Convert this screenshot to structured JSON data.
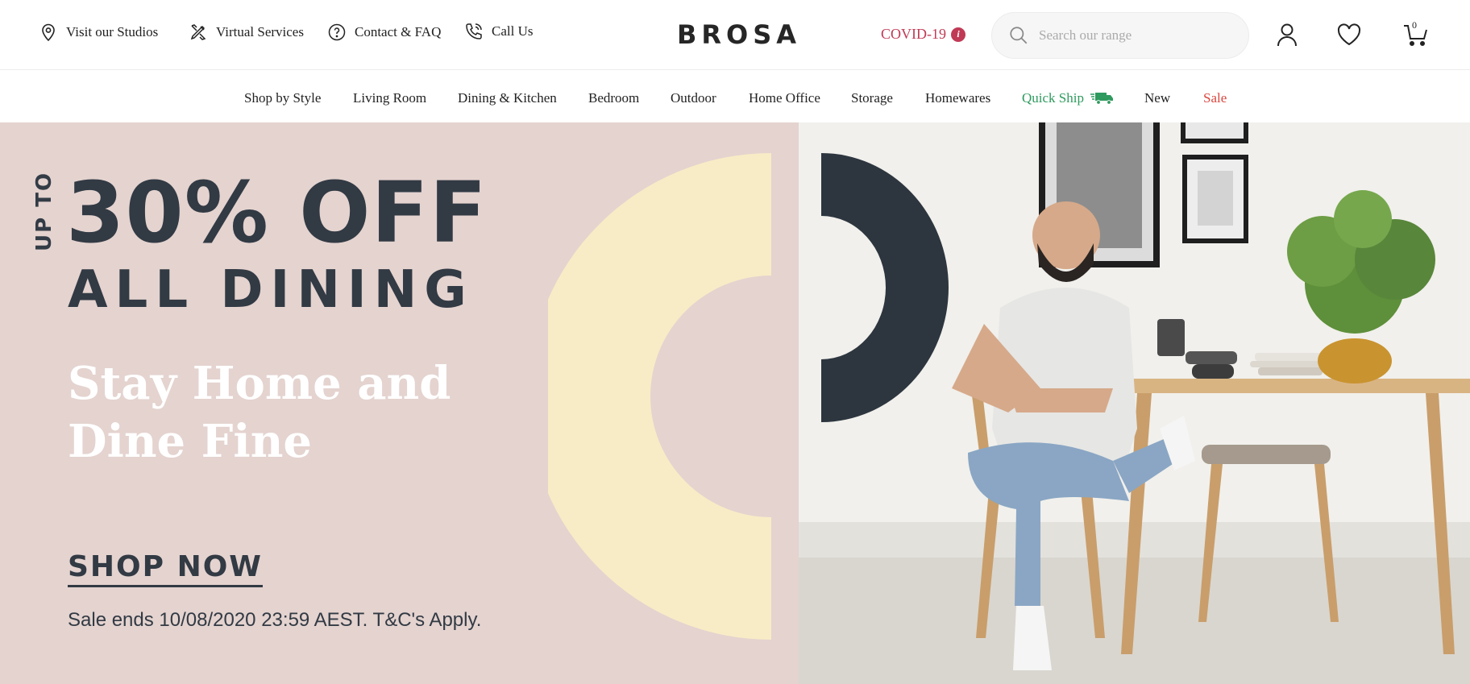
{
  "utility": {
    "studios": "Visit our Studios",
    "virtual": "Virtual Services",
    "contact": "Contact & FAQ",
    "call": "Call Us"
  },
  "brand": {
    "logo": "BROSA"
  },
  "covid": {
    "label": "COVID-19",
    "info_glyph": "i",
    "color": "#c03a55"
  },
  "search": {
    "placeholder": "Search our range",
    "value": ""
  },
  "header_icons": {
    "account": "user-icon",
    "wishlist": "heart-icon",
    "cart": "cart-icon",
    "cart_count": "0"
  },
  "nav": {
    "items": [
      {
        "label": "Shop by Style"
      },
      {
        "label": "Living Room"
      },
      {
        "label": "Dining & Kitchen"
      },
      {
        "label": "Bedroom"
      },
      {
        "label": "Outdoor"
      },
      {
        "label": "Home Office"
      },
      {
        "label": "Storage"
      },
      {
        "label": "Homewares"
      },
      {
        "label": "Quick Ship",
        "icon": "truck-icon",
        "color": "#2e9a5e"
      },
      {
        "label": "New"
      },
      {
        "label": "Sale",
        "color": "#d9473f"
      }
    ]
  },
  "hero": {
    "up_to": "UP TO",
    "headline": "30% OFF",
    "subhead": "ALL DINING",
    "tagline": "Stay Home and Dine Fine",
    "cta": "SHOP NOW",
    "disclaimer": "Sale ends 10/08/2020 23:59 AEST. T&C's Apply.",
    "colors": {
      "panel": "#e4d3cf",
      "ink": "#323a44",
      "cream": "#f8ecc6"
    }
  }
}
